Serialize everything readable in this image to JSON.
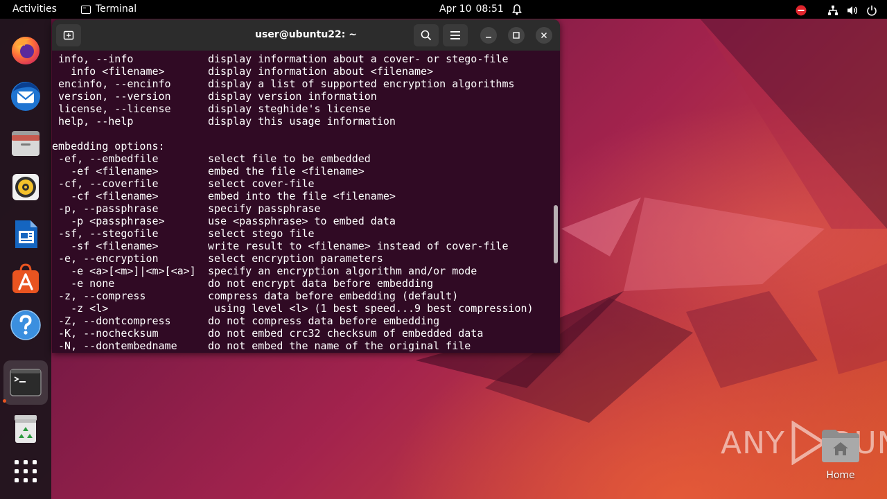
{
  "topbar": {
    "activities": "Activities",
    "app_name": "Terminal",
    "date": "Apr 10",
    "time": "08:51"
  },
  "dock": {
    "apps": [
      "firefox-icon",
      "thunderbird-icon",
      "files-icon",
      "rhythmbox-icon",
      "writer-icon",
      "app-center-icon",
      "help-icon",
      "terminal-icon",
      "trash-icon",
      "show-apps-icon"
    ]
  },
  "window": {
    "title": "user@ubuntu22: ~"
  },
  "terminal": {
    "lines": [
      {
        "c1": " info, --info",
        "c2": "display information about a cover- or stego-file"
      },
      {
        "c1": "   info <filename>",
        "c2": "display information about <filename>"
      },
      {
        "c1": " encinfo, --encinfo",
        "c2": "display a list of supported encryption algorithms"
      },
      {
        "c1": " version, --version",
        "c2": "display version information"
      },
      {
        "c1": " license, --license",
        "c2": "display steghide's license"
      },
      {
        "c1": " help, --help",
        "c2": "display this usage information"
      },
      {
        "c1": "",
        "c2": ""
      },
      {
        "c1": "embedding options:",
        "c2": ""
      },
      {
        "c1": " -ef, --embedfile",
        "c2": "select file to be embedded"
      },
      {
        "c1": "   -ef <filename>",
        "c2": "embed the file <filename>"
      },
      {
        "c1": " -cf, --coverfile",
        "c2": "select cover-file"
      },
      {
        "c1": "   -cf <filename>",
        "c2": "embed into the file <filename>"
      },
      {
        "c1": " -p, --passphrase",
        "c2": "specify passphrase"
      },
      {
        "c1": "   -p <passphrase>",
        "c2": "use <passphrase> to embed data"
      },
      {
        "c1": " -sf, --stegofile",
        "c2": "select stego file"
      },
      {
        "c1": "   -sf <filename>",
        "c2": "write result to <filename> instead of cover-file"
      },
      {
        "c1": " -e, --encryption",
        "c2": "select encryption parameters"
      },
      {
        "c1": "   -e <a>[<m>]|<m>[<a>]",
        "c2": "specify an encryption algorithm and/or mode"
      },
      {
        "c1": "   -e none",
        "c2": "do not encrypt data before embedding"
      },
      {
        "c1": " -z, --compress",
        "c2": "compress data before embedding (default)"
      },
      {
        "c1": "   -z <l>",
        "c2": " using level <l> (1 best speed...9 best compression)"
      },
      {
        "c1": " -Z, --dontcompress",
        "c2": "do not compress data before embedding"
      },
      {
        "c1": " -K, --nochecksum",
        "c2": "do not embed crc32 checksum of embedded data"
      },
      {
        "c1": " -N, --dontembedname",
        "c2": "do not embed the name of the original file"
      }
    ]
  },
  "desktop": {
    "home_label": "Home",
    "watermark_left": "ANY",
    "watermark_right": "RUN"
  },
  "colors": {
    "terminal_bg": "#300a24",
    "accent": "#e95420"
  }
}
